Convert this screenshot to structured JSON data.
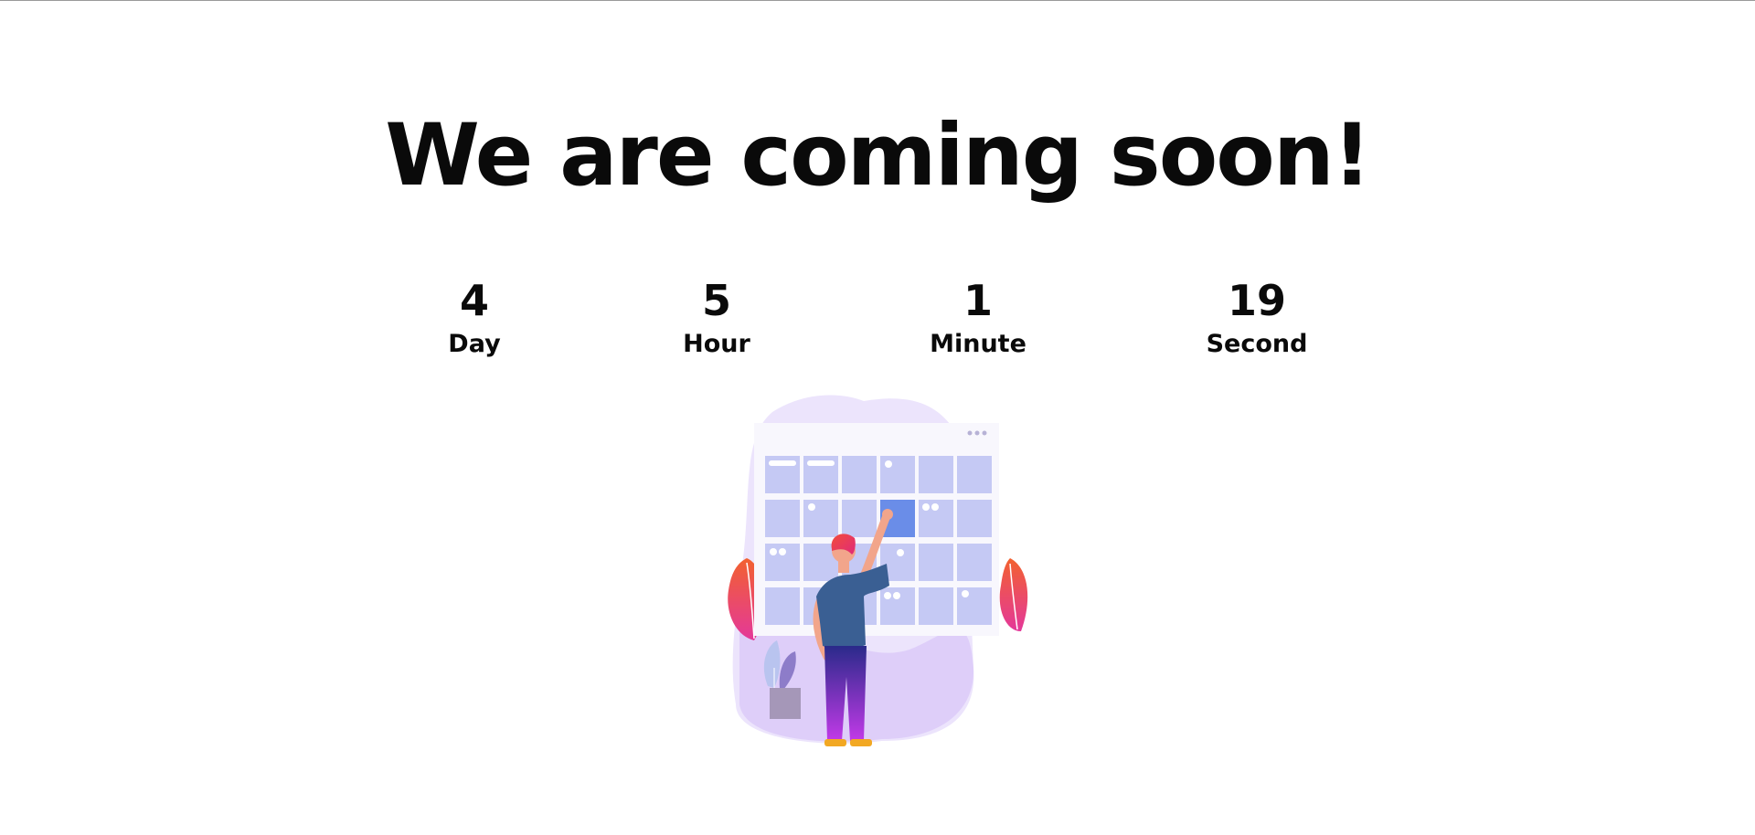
{
  "headline": "We are coming soon!",
  "countdown": [
    {
      "value": "4",
      "unit": "Day"
    },
    {
      "value": "5",
      "unit": "Hour"
    },
    {
      "value": "1",
      "unit": "Minute"
    },
    {
      "value": "19",
      "unit": "Second"
    }
  ],
  "colors": {
    "text": "#0a0a0a",
    "calendar_cell": "#c5c9f4",
    "calendar_highlight": "#6a8de8",
    "blob": "#e5d7fb",
    "shirt": "#3a5f93",
    "hair": "#e83160"
  },
  "illustration": {
    "icon": "calendar-person-illustration"
  }
}
